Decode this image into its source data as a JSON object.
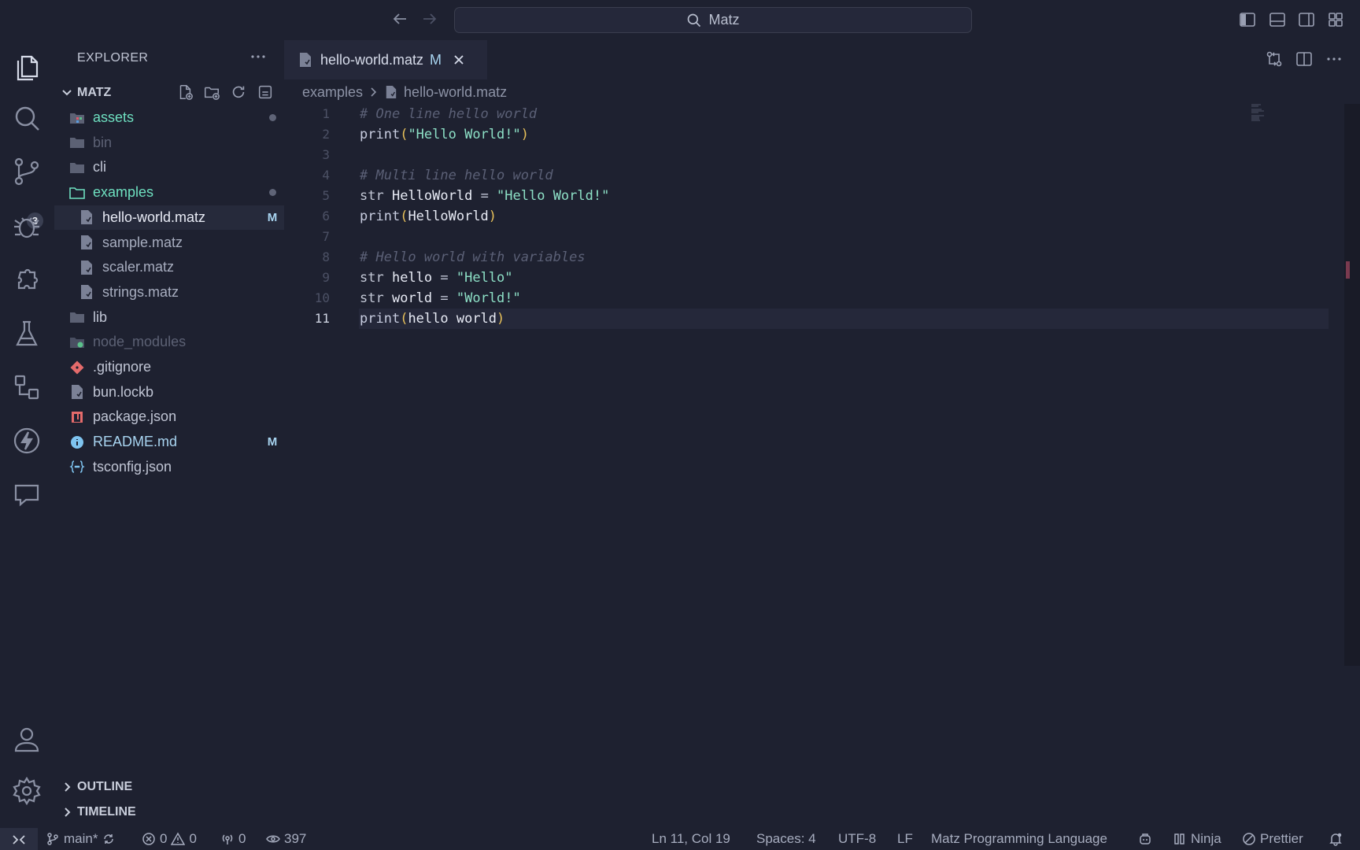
{
  "titlebar": {
    "search_text": "Matz"
  },
  "activity": {
    "source_control_badge": "3"
  },
  "explorer": {
    "header": "EXPLORER",
    "root": "MATZ",
    "items": [
      {
        "label": "assets",
        "decoration": "",
        "color": "#6ee0c0",
        "icon": "folder-assets-icon"
      },
      {
        "label": "bin",
        "decoration": "",
        "color": "#5c6174",
        "icon": "folder-icon"
      },
      {
        "label": "cli",
        "decoration": "",
        "color": "#c0c5d4",
        "icon": "folder-icon"
      },
      {
        "label": "examples",
        "decoration": "",
        "color": "#6ee0c0",
        "icon": "folder-open-icon"
      },
      {
        "label": "hello-world.matz",
        "decoration": "M",
        "color": "#e8ebf5",
        "icon": "file-icon"
      },
      {
        "label": "sample.matz",
        "decoration": "",
        "color": "#a7adbf",
        "icon": "file-icon"
      },
      {
        "label": "scaler.matz",
        "decoration": "",
        "color": "#a7adbf",
        "icon": "file-icon"
      },
      {
        "label": "strings.matz",
        "decoration": "",
        "color": "#a7adbf",
        "icon": "file-icon"
      },
      {
        "label": "lib",
        "decoration": "",
        "color": "#c0c5d4",
        "icon": "folder-icon"
      },
      {
        "label": "node_modules",
        "decoration": "",
        "color": "#5c6174",
        "icon": "folder-node-icon"
      },
      {
        "label": ".gitignore",
        "decoration": "",
        "color": "#c0c5d4",
        "icon": "git-icon"
      },
      {
        "label": "bun.lockb",
        "decoration": "",
        "color": "#c0c5d4",
        "icon": "file-icon"
      },
      {
        "label": "package.json",
        "decoration": "",
        "color": "#c0c5d4",
        "icon": "npm-icon"
      },
      {
        "label": "README.md",
        "decoration": "M",
        "color": "#a8d4f0",
        "icon": "info-icon"
      },
      {
        "label": "tsconfig.json",
        "decoration": "",
        "color": "#c0c5d4",
        "icon": "json-icon"
      }
    ],
    "outline": "OUTLINE",
    "timeline": "TIMELINE"
  },
  "editor": {
    "tab_label": "hello-world.matz",
    "tab_status": "M",
    "breadcrumb_folder": "examples",
    "breadcrumb_file": "hello-world.matz",
    "line_numbers": [
      "1",
      "2",
      "3",
      "4",
      "5",
      "6",
      "7",
      "8",
      "9",
      "10",
      "11"
    ]
  },
  "status": {
    "branch": "main*",
    "errors": "0",
    "warnings": "0",
    "ports": "0",
    "views": "397",
    "position": "Ln 11, Col 19",
    "spaces": "Spaces: 4",
    "encoding": "UTF-8",
    "eol": "LF",
    "language": "Matz Programming Language",
    "ninja": "Ninja",
    "prettier": "Prettier"
  }
}
